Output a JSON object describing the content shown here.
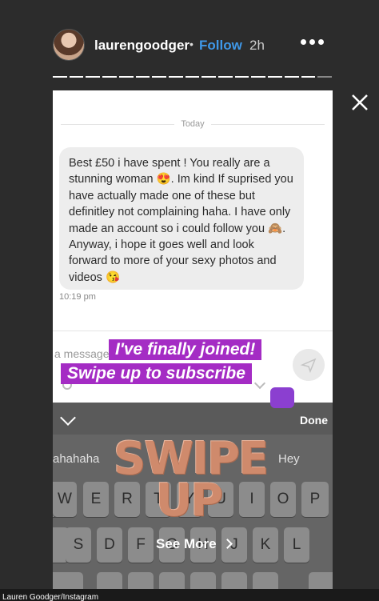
{
  "header": {
    "username": "laurengoodger",
    "separator": "•",
    "follow_label": "Follow",
    "time": "2h"
  },
  "chat": {
    "date_divider": "Today",
    "message": "Best £50 i have spent ! You really are a stunning woman 😍. Im kind If suprised you have actually made one of these but definitley not complaining haha. I have only made an account so i could follow you 🙈. Anyway, i hope it goes well and look forward to more of your sexy photos and videos 😘",
    "message_time": "10:19 pm",
    "composer_placeholder": "a message"
  },
  "keyboard": {
    "done_label": "Done",
    "suggestions": [
      "ahahaha",
      "Hey"
    ],
    "row1": [
      "W",
      "E",
      "R",
      "T",
      "Y",
      "U",
      "I",
      "O",
      "P"
    ],
    "row2": [
      "S",
      "D",
      "F",
      "G",
      "H",
      "J",
      "K",
      "L"
    ]
  },
  "overlay": {
    "sticker_line1": "I've finally joined!",
    "sticker_line2": "Swipe up to subscribe",
    "swipe_line1": "SWIPE",
    "swipe_line2": "UP",
    "see_more_label": "See More"
  },
  "credit": "Lauren Goodger/Instagram",
  "colors": {
    "follow": "#3f98e8",
    "sticker_bg": "#a42cc4",
    "swipe_text": "#cf8a6c",
    "heart": "#8b3fd0"
  },
  "icons": [
    "more-options-icon",
    "close-icon",
    "send-icon",
    "attach-icon",
    "chevron-down-icon",
    "chevron-right-icon",
    "purple-heart-icon"
  ]
}
